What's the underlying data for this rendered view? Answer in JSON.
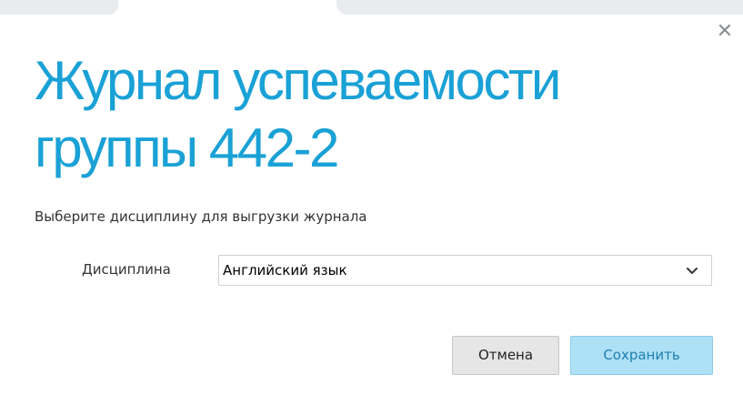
{
  "dialog": {
    "title": "Журнал успеваемости группы 442-2",
    "close_icon": "close-icon",
    "close_glyph": "✕",
    "subtitle": "Выберите дисциплину для выгрузки журнала",
    "discipline": {
      "label": "Дисциплина",
      "selected_value": "Английский язык",
      "dropdown_icon": "chevron-down-icon"
    },
    "buttons": {
      "cancel_label": "Отмена",
      "save_label": "Сохранить"
    }
  },
  "colors": {
    "title": "#1aa1d6",
    "save_button_bg": "#aee0f6",
    "save_button_text": "#1f7fae",
    "cancel_button_bg": "#e6e6e6"
  }
}
